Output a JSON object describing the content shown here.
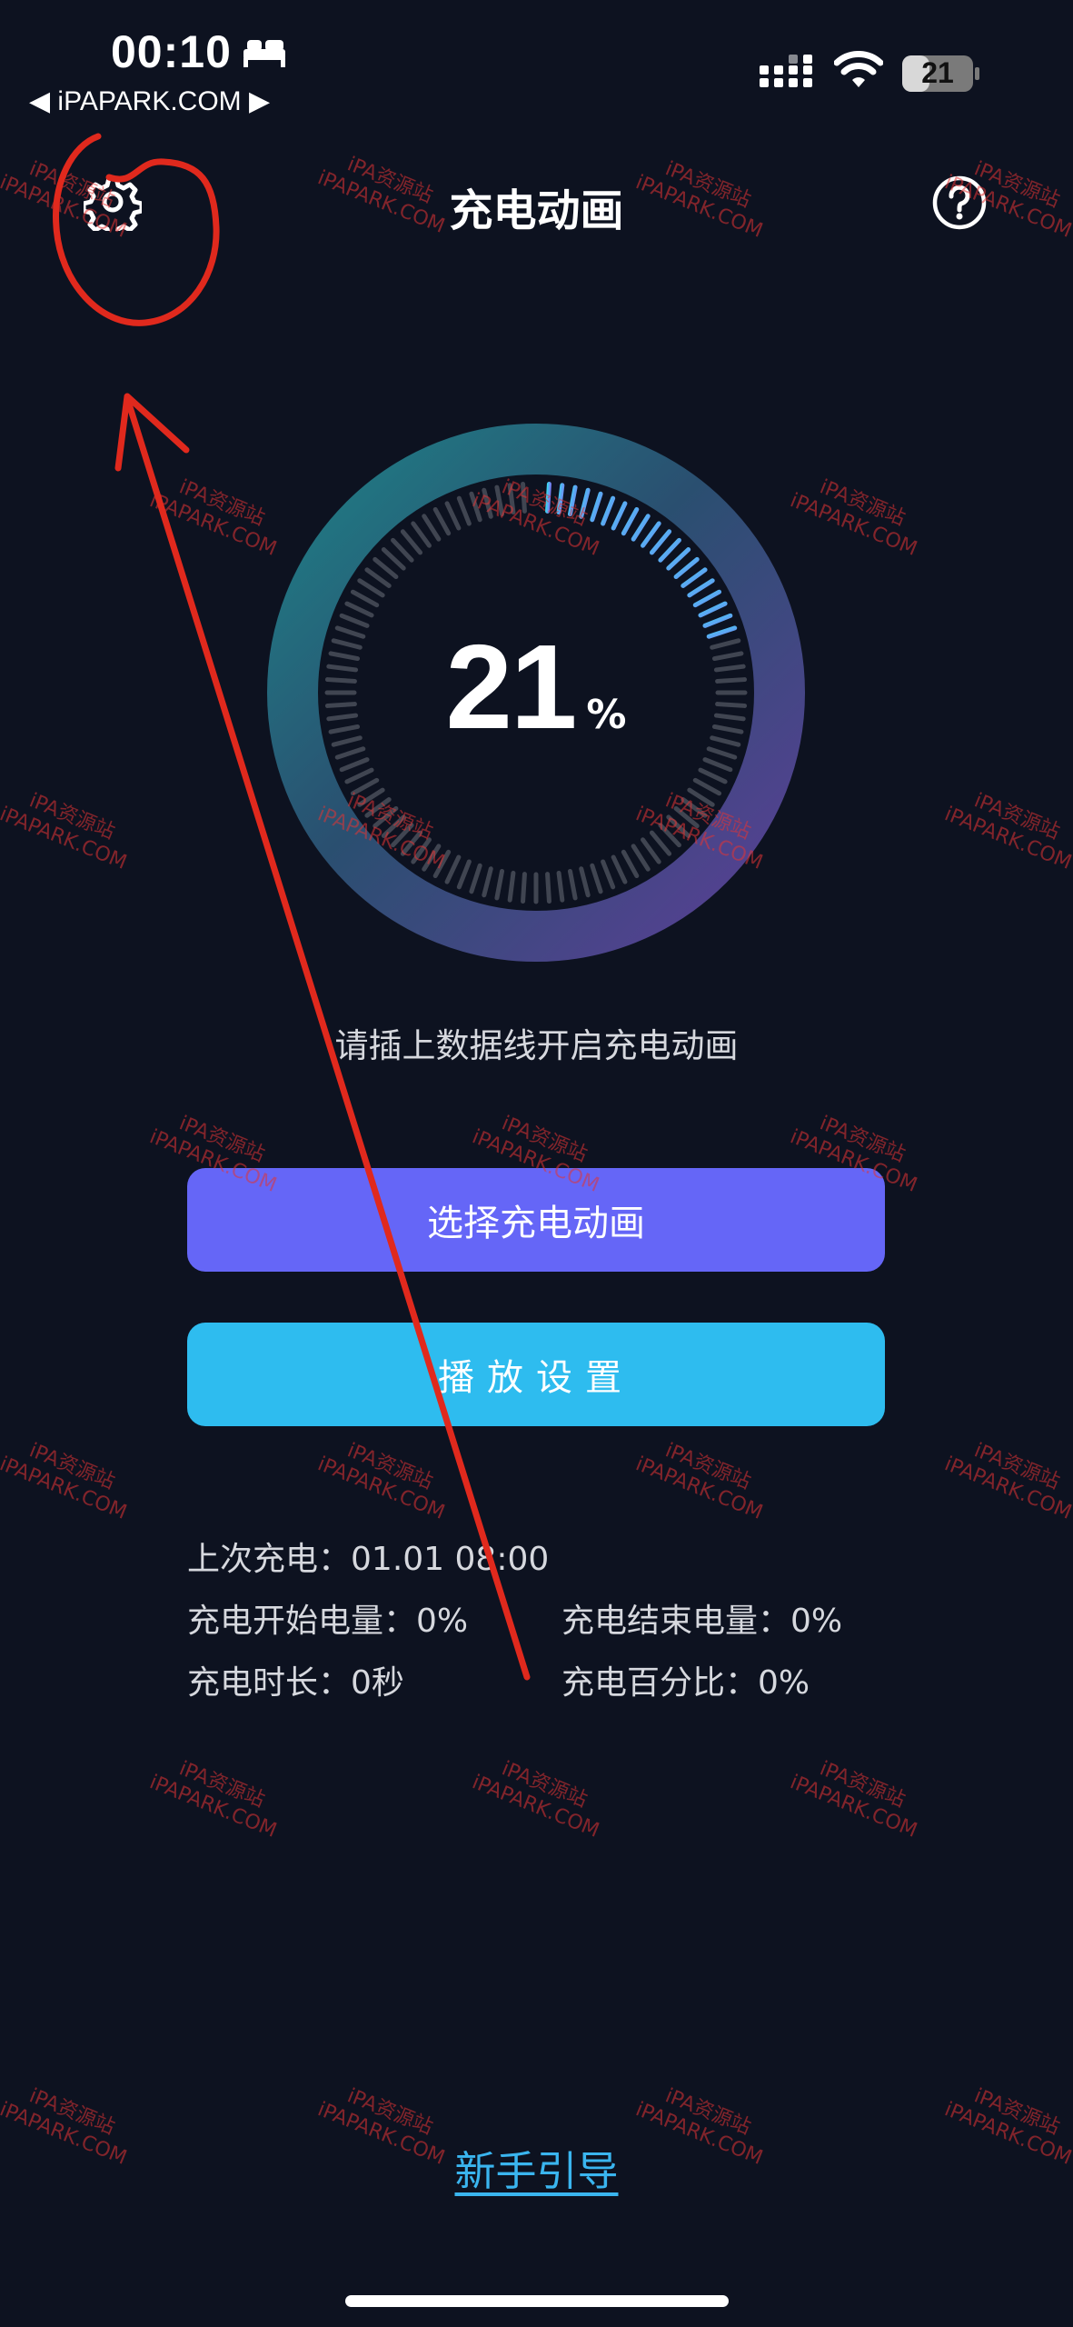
{
  "status_bar": {
    "time": "00:10",
    "back_label": "◀ iPAPARK.COM ▶",
    "battery_level": "21"
  },
  "header": {
    "title": "充电动画"
  },
  "charge": {
    "percent": "21",
    "percent_sign": "%",
    "hint": "请插上数据线开启充电动画"
  },
  "buttons": {
    "choose_animation": "选择充电动画",
    "play_settings": "播放设置"
  },
  "stats": {
    "last_charge_label": "上次充电：",
    "last_charge_value": "01.01 08:00",
    "start_level_label": "充电开始电量：",
    "start_level_value": "0%",
    "end_level_label": "充电结束电量：",
    "end_level_value": "0%",
    "duration_label": "充电时长：",
    "duration_value": "0秒",
    "percentage_label": "充电百分比：",
    "percentage_value": "0%"
  },
  "footer": {
    "guide_link": "新手引导"
  },
  "watermark": {
    "line1": "iPA资源站",
    "line2": "iPAPARK.COM"
  },
  "colors": {
    "background": "#0d1220",
    "primary_button": "#6566f7",
    "secondary_button": "#2ebcef",
    "link": "#3ab5ef",
    "annotation": "#e0291d"
  },
  "icons": {
    "status": [
      "bed-icon",
      "signal-icon",
      "wifi-icon",
      "battery-icon"
    ],
    "header": [
      "gear-icon",
      "help-icon"
    ]
  }
}
